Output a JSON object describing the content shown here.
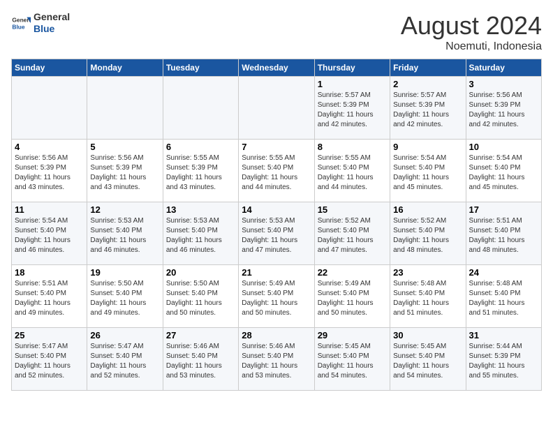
{
  "header": {
    "logo_general": "General",
    "logo_blue": "Blue",
    "month_year": "August 2024",
    "location": "Noemuti, Indonesia"
  },
  "weekdays": [
    "Sunday",
    "Monday",
    "Tuesday",
    "Wednesday",
    "Thursday",
    "Friday",
    "Saturday"
  ],
  "weeks": [
    [
      {
        "day": "",
        "info": ""
      },
      {
        "day": "",
        "info": ""
      },
      {
        "day": "",
        "info": ""
      },
      {
        "day": "",
        "info": ""
      },
      {
        "day": "1",
        "info": "Sunrise: 5:57 AM\nSunset: 5:39 PM\nDaylight: 11 hours\nand 42 minutes."
      },
      {
        "day": "2",
        "info": "Sunrise: 5:57 AM\nSunset: 5:39 PM\nDaylight: 11 hours\nand 42 minutes."
      },
      {
        "day": "3",
        "info": "Sunrise: 5:56 AM\nSunset: 5:39 PM\nDaylight: 11 hours\nand 42 minutes."
      }
    ],
    [
      {
        "day": "4",
        "info": "Sunrise: 5:56 AM\nSunset: 5:39 PM\nDaylight: 11 hours\nand 43 minutes."
      },
      {
        "day": "5",
        "info": "Sunrise: 5:56 AM\nSunset: 5:39 PM\nDaylight: 11 hours\nand 43 minutes."
      },
      {
        "day": "6",
        "info": "Sunrise: 5:55 AM\nSunset: 5:39 PM\nDaylight: 11 hours\nand 43 minutes."
      },
      {
        "day": "7",
        "info": "Sunrise: 5:55 AM\nSunset: 5:40 PM\nDaylight: 11 hours\nand 44 minutes."
      },
      {
        "day": "8",
        "info": "Sunrise: 5:55 AM\nSunset: 5:40 PM\nDaylight: 11 hours\nand 44 minutes."
      },
      {
        "day": "9",
        "info": "Sunrise: 5:54 AM\nSunset: 5:40 PM\nDaylight: 11 hours\nand 45 minutes."
      },
      {
        "day": "10",
        "info": "Sunrise: 5:54 AM\nSunset: 5:40 PM\nDaylight: 11 hours\nand 45 minutes."
      }
    ],
    [
      {
        "day": "11",
        "info": "Sunrise: 5:54 AM\nSunset: 5:40 PM\nDaylight: 11 hours\nand 46 minutes."
      },
      {
        "day": "12",
        "info": "Sunrise: 5:53 AM\nSunset: 5:40 PM\nDaylight: 11 hours\nand 46 minutes."
      },
      {
        "day": "13",
        "info": "Sunrise: 5:53 AM\nSunset: 5:40 PM\nDaylight: 11 hours\nand 46 minutes."
      },
      {
        "day": "14",
        "info": "Sunrise: 5:53 AM\nSunset: 5:40 PM\nDaylight: 11 hours\nand 47 minutes."
      },
      {
        "day": "15",
        "info": "Sunrise: 5:52 AM\nSunset: 5:40 PM\nDaylight: 11 hours\nand 47 minutes."
      },
      {
        "day": "16",
        "info": "Sunrise: 5:52 AM\nSunset: 5:40 PM\nDaylight: 11 hours\nand 48 minutes."
      },
      {
        "day": "17",
        "info": "Sunrise: 5:51 AM\nSunset: 5:40 PM\nDaylight: 11 hours\nand 48 minutes."
      }
    ],
    [
      {
        "day": "18",
        "info": "Sunrise: 5:51 AM\nSunset: 5:40 PM\nDaylight: 11 hours\nand 49 minutes."
      },
      {
        "day": "19",
        "info": "Sunrise: 5:50 AM\nSunset: 5:40 PM\nDaylight: 11 hours\nand 49 minutes."
      },
      {
        "day": "20",
        "info": "Sunrise: 5:50 AM\nSunset: 5:40 PM\nDaylight: 11 hours\nand 50 minutes."
      },
      {
        "day": "21",
        "info": "Sunrise: 5:49 AM\nSunset: 5:40 PM\nDaylight: 11 hours\nand 50 minutes."
      },
      {
        "day": "22",
        "info": "Sunrise: 5:49 AM\nSunset: 5:40 PM\nDaylight: 11 hours\nand 50 minutes."
      },
      {
        "day": "23",
        "info": "Sunrise: 5:48 AM\nSunset: 5:40 PM\nDaylight: 11 hours\nand 51 minutes."
      },
      {
        "day": "24",
        "info": "Sunrise: 5:48 AM\nSunset: 5:40 PM\nDaylight: 11 hours\nand 51 minutes."
      }
    ],
    [
      {
        "day": "25",
        "info": "Sunrise: 5:47 AM\nSunset: 5:40 PM\nDaylight: 11 hours\nand 52 minutes."
      },
      {
        "day": "26",
        "info": "Sunrise: 5:47 AM\nSunset: 5:40 PM\nDaylight: 11 hours\nand 52 minutes."
      },
      {
        "day": "27",
        "info": "Sunrise: 5:46 AM\nSunset: 5:40 PM\nDaylight: 11 hours\nand 53 minutes."
      },
      {
        "day": "28",
        "info": "Sunrise: 5:46 AM\nSunset: 5:40 PM\nDaylight: 11 hours\nand 53 minutes."
      },
      {
        "day": "29",
        "info": "Sunrise: 5:45 AM\nSunset: 5:40 PM\nDaylight: 11 hours\nand 54 minutes."
      },
      {
        "day": "30",
        "info": "Sunrise: 5:45 AM\nSunset: 5:40 PM\nDaylight: 11 hours\nand 54 minutes."
      },
      {
        "day": "31",
        "info": "Sunrise: 5:44 AM\nSunset: 5:39 PM\nDaylight: 11 hours\nand 55 minutes."
      }
    ]
  ]
}
